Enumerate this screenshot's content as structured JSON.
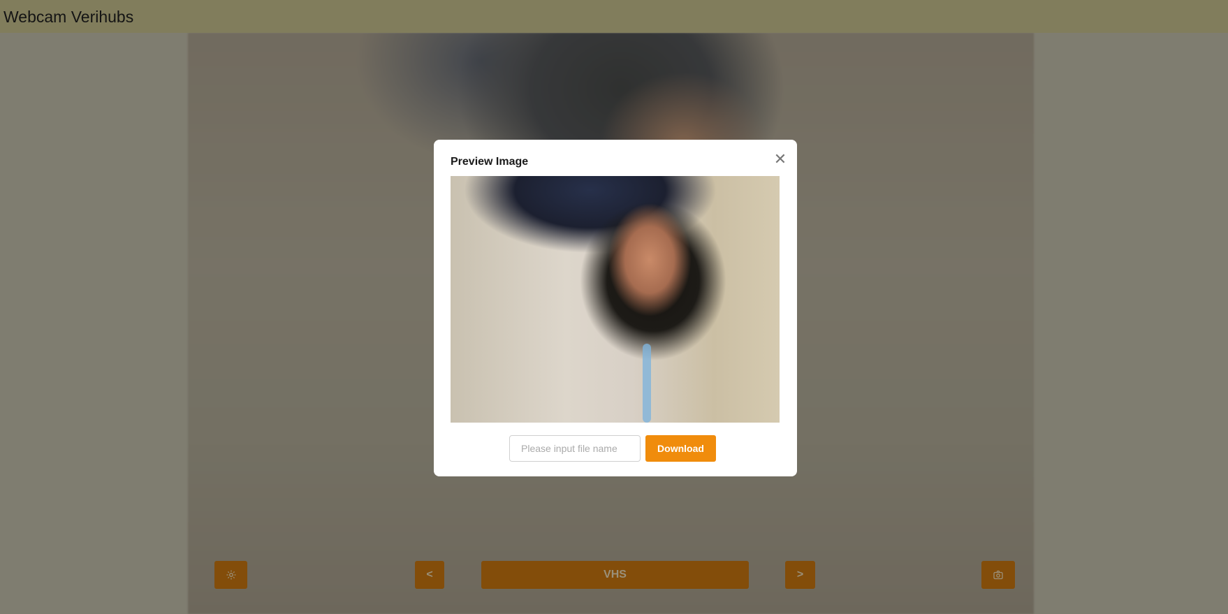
{
  "header": {
    "title": "Webcam Verihubs"
  },
  "controls": {
    "prev_label": "<",
    "filter_label": "VHS",
    "next_label": ">",
    "settings_icon": "gear-icon",
    "capture_icon": "camera-icon"
  },
  "modal": {
    "title": "Preview Image",
    "close_icon": "close-icon",
    "filename_placeholder": "Please input file name",
    "filename_value": "",
    "download_label": "Download"
  },
  "colors": {
    "accent": "#f08c0c",
    "header": "#817d5c"
  }
}
